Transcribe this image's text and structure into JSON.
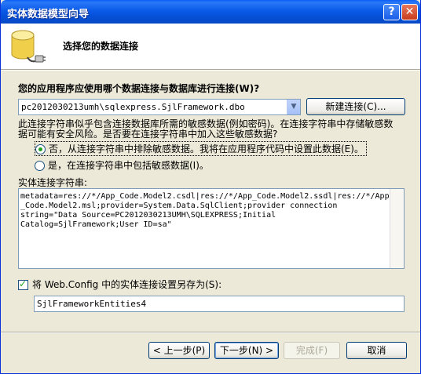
{
  "window": {
    "title": "实体数据模型向导",
    "help_label": "?",
    "close_label": "✕"
  },
  "header": {
    "title": "选择您的数据连接",
    "icon": "database-icon"
  },
  "question": "您的应用程序应使用哪个数据连接与数据库进行连接(W)?",
  "connection_combo": {
    "value": "pc2012030213umh\\sqlexpress.SjlFramework.dbo"
  },
  "buttons": {
    "new_connection": "新建连接(C)...",
    "back": "< 上一步(P)",
    "next": "下一步(N) >",
    "finish": "完成(F)",
    "cancel": "取消"
  },
  "info_lines": [
    "此连接字符串似乎包含连接数据库所需的敏感数据(例如密码)。在连接字符串中存储敏感数",
    "据可能有安全风险。是否要在连接字符串中加入这些敏感数据?"
  ],
  "radio_options": [
    {
      "label": "否，从连接字符串中排除敏感数据。我将在应用程序代码中设置此数据(E)。",
      "checked": true
    },
    {
      "label": "是，在连接字符串中包括敏感数据(I)。",
      "checked": false
    }
  ],
  "connection_string": {
    "label": "实体连接字符串:",
    "lines": [
      "metadata=res://*/App_Code.Model2.csdl|res://*/App_Code.Model2.ssdl|res://*/App",
      "_Code.Model2.msl;provider=System.Data.SqlClient;provider connection",
      "string=\"Data Source=PC2012030213UMH\\SQLEXPRESS;Initial",
      "Catalog=SjlFramework;User ID=sa\""
    ]
  },
  "save_setting": {
    "label": "将 Web.Config 中的实体连接设置另存为(S):",
    "checked": true,
    "value": "SjlFrameworkEntities4"
  }
}
